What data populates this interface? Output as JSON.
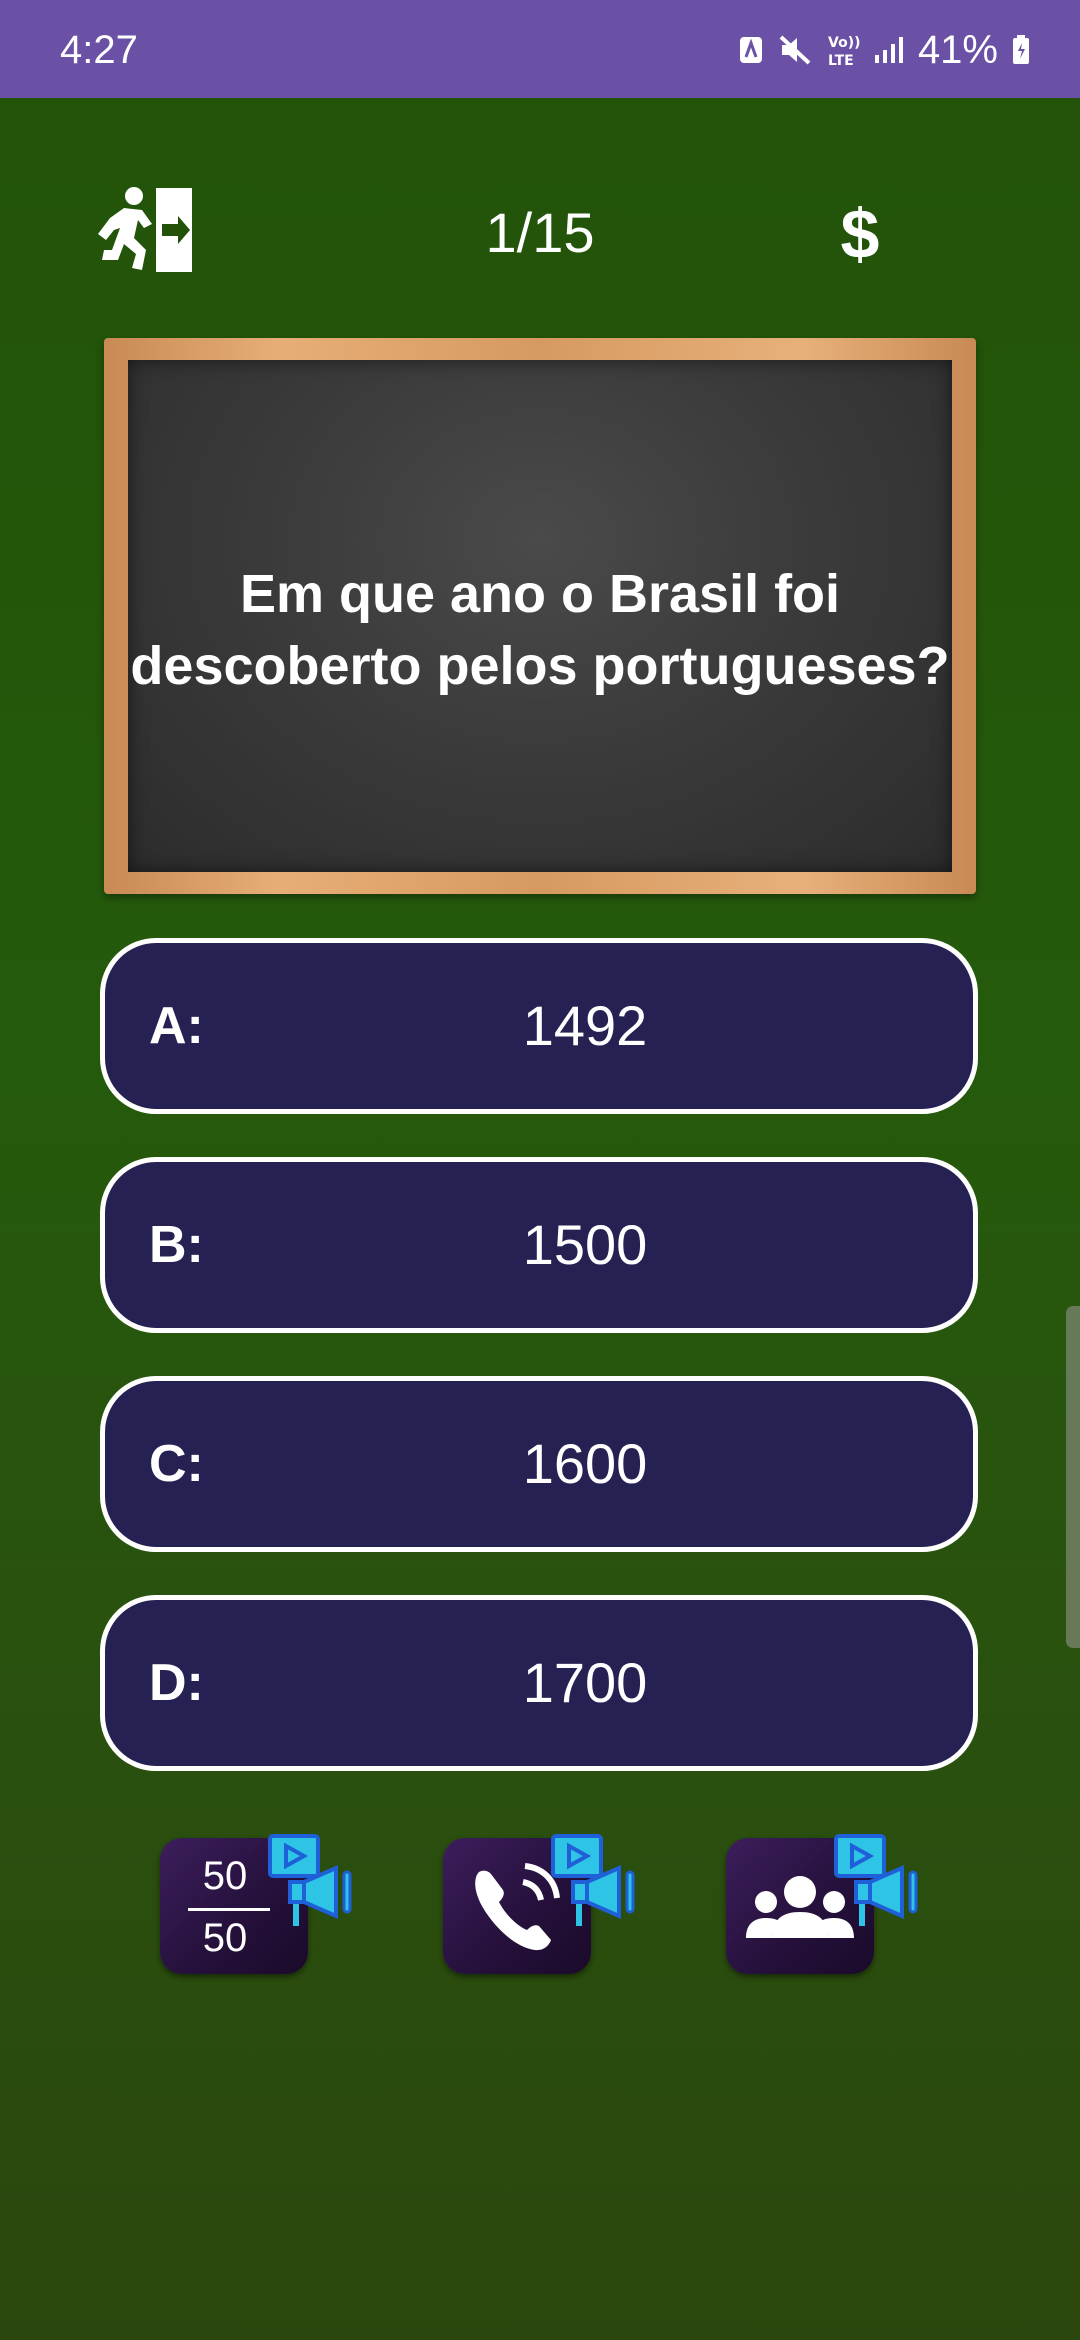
{
  "status_bar": {
    "time": "4:27",
    "battery_text": "41%",
    "icons": [
      "nfc-icon",
      "mute-icon",
      "volte-icon",
      "signal-icon",
      "battery-icon"
    ]
  },
  "header": {
    "exit_icon": "exit-door-icon",
    "question_counter": "1/15",
    "prize_symbol": "$"
  },
  "question": {
    "text": "Em que ano o Brasil foi\ndescoberto pelos portugueses?"
  },
  "answers": [
    {
      "letter": "A:",
      "text": "1492"
    },
    {
      "letter": "B:",
      "text": "1500"
    },
    {
      "letter": "C:",
      "text": "1600"
    },
    {
      "letter": "D:",
      "text": "1700"
    }
  ],
  "lifelines": {
    "fifty_fifty": {
      "top": "50",
      "bottom": "50",
      "icon": "fifty-fifty-icon",
      "badge": "video-ad-icon"
    },
    "phone": {
      "icon": "phone-call-icon",
      "badge": "video-ad-icon"
    },
    "audience": {
      "icon": "audience-icon",
      "badge": "video-ad-icon"
    }
  },
  "colors": {
    "status_bar": "#6a51a6",
    "background": "#255a0c",
    "answer_fill": "#252253",
    "answer_border": "#ffffff",
    "chalkboard_frame": "#e0a46c",
    "chalkboard_surface": "#3b3b3b",
    "ad_badge": "#2aa8e0"
  }
}
